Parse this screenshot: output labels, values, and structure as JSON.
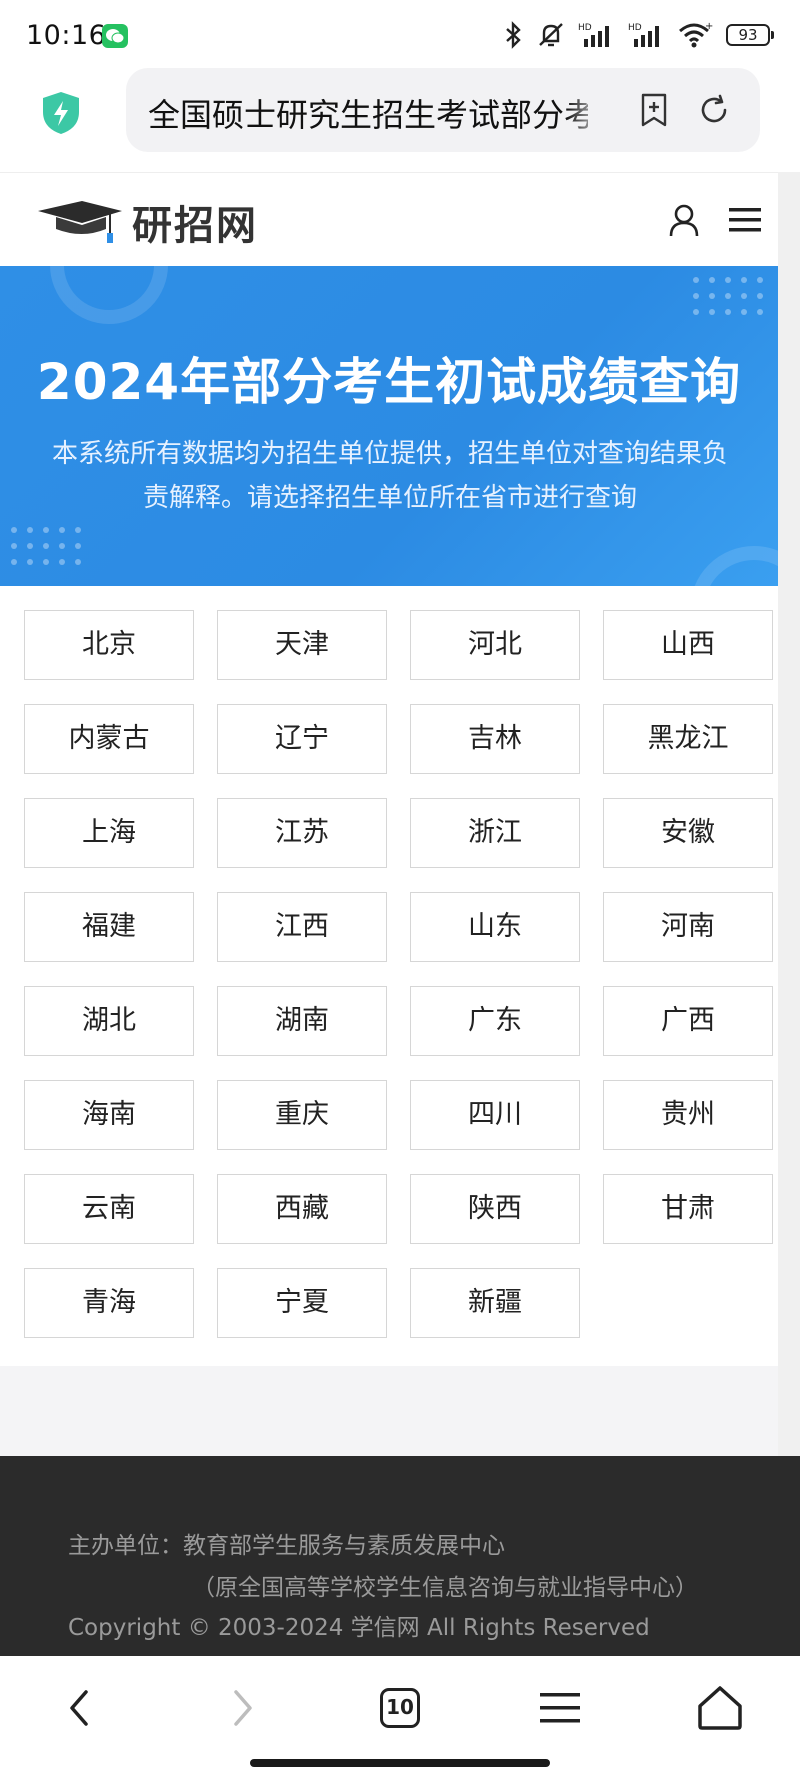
{
  "status_bar": {
    "time": "10:16",
    "battery": "93",
    "icons": [
      "wechat-icon",
      "bluetooth-icon",
      "silent-icon",
      "signal-hd-icon",
      "signal-hd-icon",
      "wifi-icon",
      "battery-icon"
    ]
  },
  "browser": {
    "url_text": "全国硕士研究生招生考试部分考生初试成绩查询",
    "tabs_count": "10"
  },
  "site": {
    "logo_text": "研招网"
  },
  "hero": {
    "title": "2024年部分考生初试成绩查询",
    "description": "本系统所有数据均为招生单位提供，招生单位对查询结果负责解释。请选择招生单位所在省市进行查询"
  },
  "provinces": [
    "北京",
    "天津",
    "河北",
    "山西",
    "内蒙古",
    "辽宁",
    "吉林",
    "黑龙江",
    "上海",
    "江苏",
    "浙江",
    "安徽",
    "福建",
    "江西",
    "山东",
    "河南",
    "湖北",
    "湖南",
    "广东",
    "广西",
    "海南",
    "重庆",
    "四川",
    "贵州",
    "云南",
    "西藏",
    "陕西",
    "甘肃",
    "青海",
    "宁夏",
    "新疆"
  ],
  "footer": {
    "host": "主办单位：教育部学生服务与素质发展中心",
    "host_note": "（原全国高等学校学生信息咨询与就业指导中心）",
    "copyright": "Copyright © 2003-2024 学信网 All Rights Reserved"
  },
  "colors": {
    "hero_blue": "#2f8fe6",
    "footer_bg": "#2b2b2b",
    "shield_green": "#3cc8a5"
  }
}
